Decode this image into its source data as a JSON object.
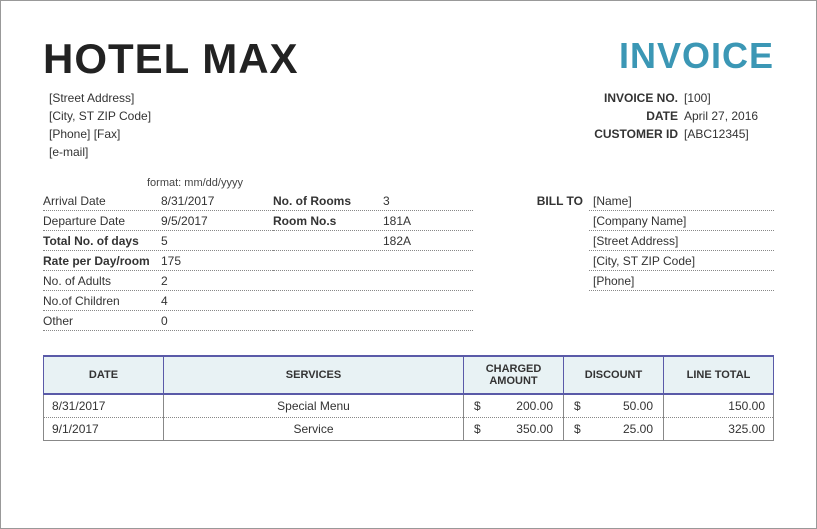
{
  "header": {
    "hotel_name": "HOTEL MAX",
    "invoice_title": "INVOICE"
  },
  "address": {
    "street": "[Street Address]",
    "city": "[City, ST  ZIP Code]",
    "phone": "[Phone] [Fax]",
    "email": "[e-mail]"
  },
  "meta": {
    "invoice_no_label": "INVOICE NO.",
    "invoice_no": "[100]",
    "date_label": "DATE",
    "date": "April 27, 2016",
    "customer_id_label": "CUSTOMER ID",
    "customer_id": "[ABC12345]"
  },
  "format_hint": "format: mm/dd/yyyy",
  "stay": {
    "arrival_label": "Arrival Date",
    "arrival": "8/31/2017",
    "departure_label": "Departure Date",
    "departure": "9/5/2017",
    "total_days_label": "Total No. of days",
    "total_days": "5",
    "rate_label": "Rate per Day/room",
    "rate": "175",
    "adults_label": "No. of Adults",
    "adults": "2",
    "children_label": "No.of Children",
    "children": "4",
    "other_label": "Other",
    "other": "0"
  },
  "rooms": {
    "num_rooms_label": "No. of Rooms",
    "num_rooms": "3",
    "room_nos_label": "Room No.s",
    "room_nos": [
      "181A",
      "182A"
    ]
  },
  "bill_to": {
    "label": "BILL TO",
    "name": "[Name]",
    "company": "[Company Name]",
    "street": "[Street Address]",
    "city": "[City, ST  ZIP Code]",
    "phone": "[Phone]"
  },
  "table": {
    "headers": {
      "date": "DATE",
      "services": "SERVICES",
      "charged": "CHARGED AMOUNT",
      "discount": "DISCOUNT",
      "line_total": "LINE TOTAL"
    },
    "currency": "$",
    "rows": [
      {
        "date": "8/31/2017",
        "service": "Special Menu",
        "charged": "200.00",
        "discount": "50.00",
        "total": "150.00"
      },
      {
        "date": "9/1/2017",
        "service": "Service",
        "charged": "350.00",
        "discount": "25.00",
        "total": "325.00"
      }
    ]
  }
}
